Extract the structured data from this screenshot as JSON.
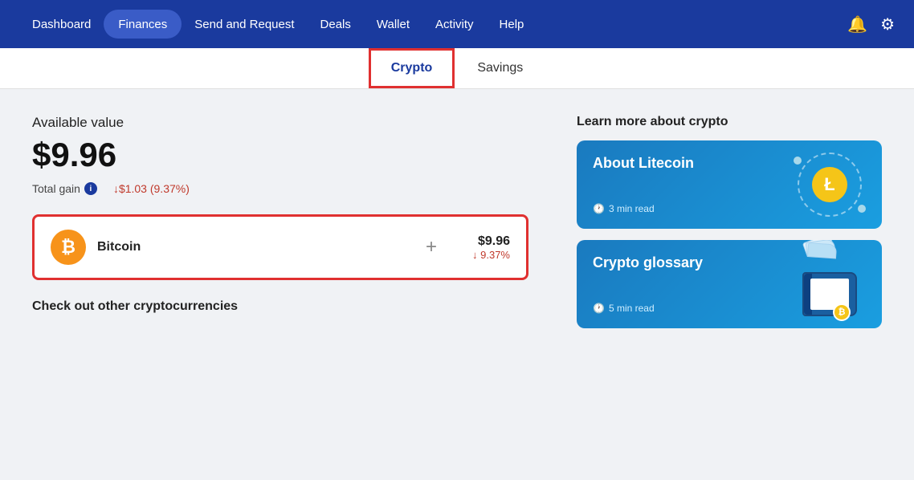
{
  "nav": {
    "items": [
      {
        "label": "Dashboard",
        "active": false
      },
      {
        "label": "Finances",
        "active": true
      },
      {
        "label": "Send and Request",
        "active": false
      },
      {
        "label": "Deals",
        "active": false
      },
      {
        "label": "Wallet",
        "active": false
      },
      {
        "label": "Activity",
        "active": false
      },
      {
        "label": "Help",
        "active": false
      }
    ]
  },
  "subnav": {
    "items": [
      {
        "label": "Crypto",
        "active": true
      },
      {
        "label": "Savings",
        "active": false
      }
    ]
  },
  "main": {
    "available_label": "Available value",
    "available_value": "$9.96",
    "total_gain_label": "Total gain",
    "total_gain_value": "↓$1.03 (9.37%)",
    "crypto_card": {
      "name": "Bitcoin",
      "plus": "+",
      "usd": "$9.96",
      "pct": "↓ 9.37%",
      "icon_letter": "₿"
    },
    "check_other": "Check out other cryptocurrencies"
  },
  "right": {
    "learn_label": "Learn more about crypto",
    "cards": [
      {
        "title": "About Litecoin",
        "time": "3 min read"
      },
      {
        "title": "Crypto glossary",
        "time": "5 min read"
      }
    ]
  }
}
